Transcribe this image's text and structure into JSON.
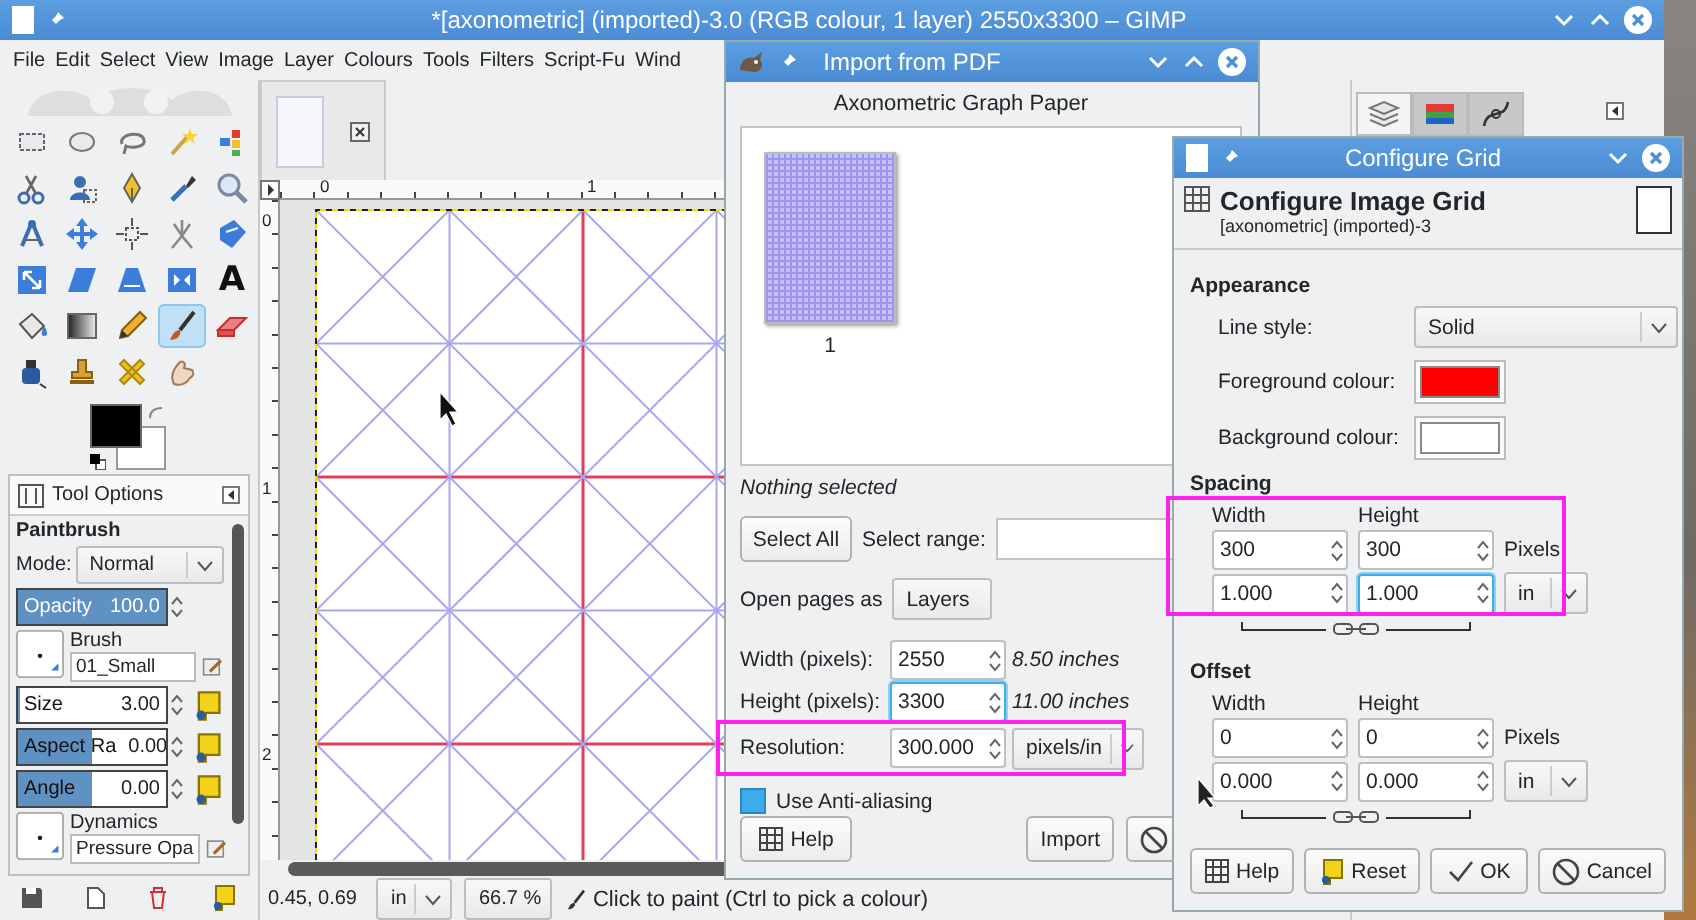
{
  "main_window": {
    "title": "*[axonometric] (imported)-3.0 (RGB colour, 1 layer) 2550x3300 – GIMP",
    "menu": [
      "File",
      "Edit",
      "Select",
      "View",
      "Image",
      "Layer",
      "Colours",
      "Tools",
      "Filters",
      "Script-Fu",
      "Wind"
    ]
  },
  "toolbox": {
    "tools": [
      {
        "kind": "rect-select",
        "selected": false
      },
      {
        "kind": "ellipse-select",
        "selected": false
      },
      {
        "kind": "free-select",
        "selected": false
      },
      {
        "kind": "fuzzy-select",
        "selected": false
      },
      {
        "kind": "color-select",
        "selected": false
      },
      {
        "kind": "scissors",
        "selected": false
      },
      {
        "kind": "foreground-select",
        "selected": false
      },
      {
        "kind": "paths",
        "selected": false
      },
      {
        "kind": "color-picker",
        "selected": false
      },
      {
        "kind": "zoom",
        "selected": false
      },
      {
        "kind": "measure",
        "selected": false
      },
      {
        "kind": "move",
        "selected": false
      },
      {
        "kind": "align",
        "selected": false
      },
      {
        "kind": "warp",
        "selected": false
      },
      {
        "kind": "transform",
        "selected": false
      },
      {
        "kind": "scale",
        "selected": false
      },
      {
        "kind": "shear",
        "selected": false
      },
      {
        "kind": "perspective",
        "selected": false
      },
      {
        "kind": "flip",
        "selected": false
      },
      {
        "kind": "text",
        "glyph": "A",
        "selected": false
      },
      {
        "kind": "bucket",
        "selected": false
      },
      {
        "kind": "gradient",
        "selected": false
      },
      {
        "kind": "pencil",
        "selected": false
      },
      {
        "kind": "paintbrush",
        "selected": true
      },
      {
        "kind": "eraser",
        "selected": false
      },
      {
        "kind": "ink",
        "selected": false
      },
      {
        "kind": "clone",
        "selected": false
      },
      {
        "kind": "heal",
        "selected": false
      },
      {
        "kind": "smudge",
        "selected": false
      }
    ]
  },
  "tool_options": {
    "tab": "Tool Options",
    "tool": "Paintbrush",
    "mode": {
      "label": "Mode:",
      "value": "Normal"
    },
    "options": [
      {
        "kind": "slider",
        "label": "Opacity",
        "value": "100.0",
        "level": 1.0,
        "reset_button": false
      },
      {
        "kind": "resource",
        "label": "Brush",
        "value": "01_Small"
      },
      {
        "kind": "slider",
        "label": "Size",
        "value": "3.00",
        "level": 0.01,
        "reset_button": true
      },
      {
        "kind": "slider",
        "label": "Aspect Ra",
        "value": "0.00",
        "level": 0.5,
        "reset_button": true
      },
      {
        "kind": "slider",
        "label": "Angle",
        "value": "0.00",
        "level": 0.5,
        "reset_button": true
      },
      {
        "kind": "resource",
        "label": "Dynamics",
        "value": "Pressure Opa"
      }
    ]
  },
  "rulers": {
    "horizontal": [
      "0",
      "1"
    ],
    "vertical": [
      "0",
      "1",
      "2"
    ]
  },
  "status_bar": {
    "coordinates": "0.45, 0.69",
    "unit": "in",
    "zoom": "66.7 %",
    "message": "Click to paint (Ctrl to pick a colour)"
  },
  "dock_tabs": [
    {
      "kind": "layers",
      "selected": true
    },
    {
      "kind": "channels",
      "selected": false
    },
    {
      "kind": "paths",
      "selected": false
    }
  ],
  "import_dialog": {
    "title": "Import from PDF",
    "document": "Axonometric Graph Paper",
    "pages": [
      {
        "label": "1",
        "selected": false
      }
    ],
    "selection_status": "Nothing selected",
    "select_all": "Select All",
    "select_range": "Select range:",
    "open_as": {
      "label": "Open pages as",
      "value": "Layers"
    },
    "size_fields": [
      {
        "label": "Width (pixels):",
        "value": "2550",
        "focused": false,
        "note": "8.50 inches"
      },
      {
        "label": "Height (pixels):",
        "value": "3300",
        "focused": true,
        "note": "11.00 inches"
      }
    ],
    "resolution": {
      "label": "Resolution:",
      "value": "300.000",
      "unit": "pixels/in",
      "focused": false,
      "highlighted": true
    },
    "antialias": {
      "label": "Use Anti-aliasing",
      "checked": true
    },
    "buttons": [
      {
        "kind": "help",
        "label": "Help"
      },
      {
        "kind": "import",
        "label": "Import"
      },
      {
        "kind": "cancel"
      }
    ]
  },
  "grid_dialog": {
    "title": "Configure Grid",
    "heading": "Configure Image Grid",
    "subtitle": "[axonometric] (imported)-3",
    "appearance": {
      "heading": "Appearance",
      "line_style": {
        "label": "Line style:",
        "value": "Solid"
      },
      "foreground": {
        "label": "Foreground colour:",
        "color": "#ff0000"
      },
      "background": {
        "label": "Background colour:",
        "color": "#ffffff"
      }
    },
    "sections": [
      {
        "heading": "Spacing",
        "highlighted": true,
        "columns": [
          "Width",
          "Height"
        ],
        "pixels": [
          {
            "value": "300",
            "focused": false
          },
          {
            "value": "300",
            "focused": false
          }
        ],
        "pixels_unit": "Pixels",
        "values": [
          {
            "value": "1.000",
            "focused": false
          },
          {
            "value": "1.000",
            "focused": true
          }
        ],
        "unit": "in"
      },
      {
        "heading": "Offset",
        "highlighted": false,
        "columns": [
          "Width",
          "Height"
        ],
        "pixels": [
          {
            "value": "0",
            "focused": false
          },
          {
            "value": "0",
            "focused": false
          }
        ],
        "pixels_unit": "Pixels",
        "values": [
          {
            "value": "0.000",
            "focused": false
          },
          {
            "value": "0.000",
            "focused": false
          }
        ],
        "unit": "in"
      }
    ],
    "buttons": [
      {
        "kind": "help",
        "label": "Help"
      },
      {
        "kind": "reset",
        "label": "Reset"
      },
      {
        "kind": "ok",
        "label": "OK"
      },
      {
        "kind": "cancel",
        "label": "Cancel"
      }
    ]
  }
}
